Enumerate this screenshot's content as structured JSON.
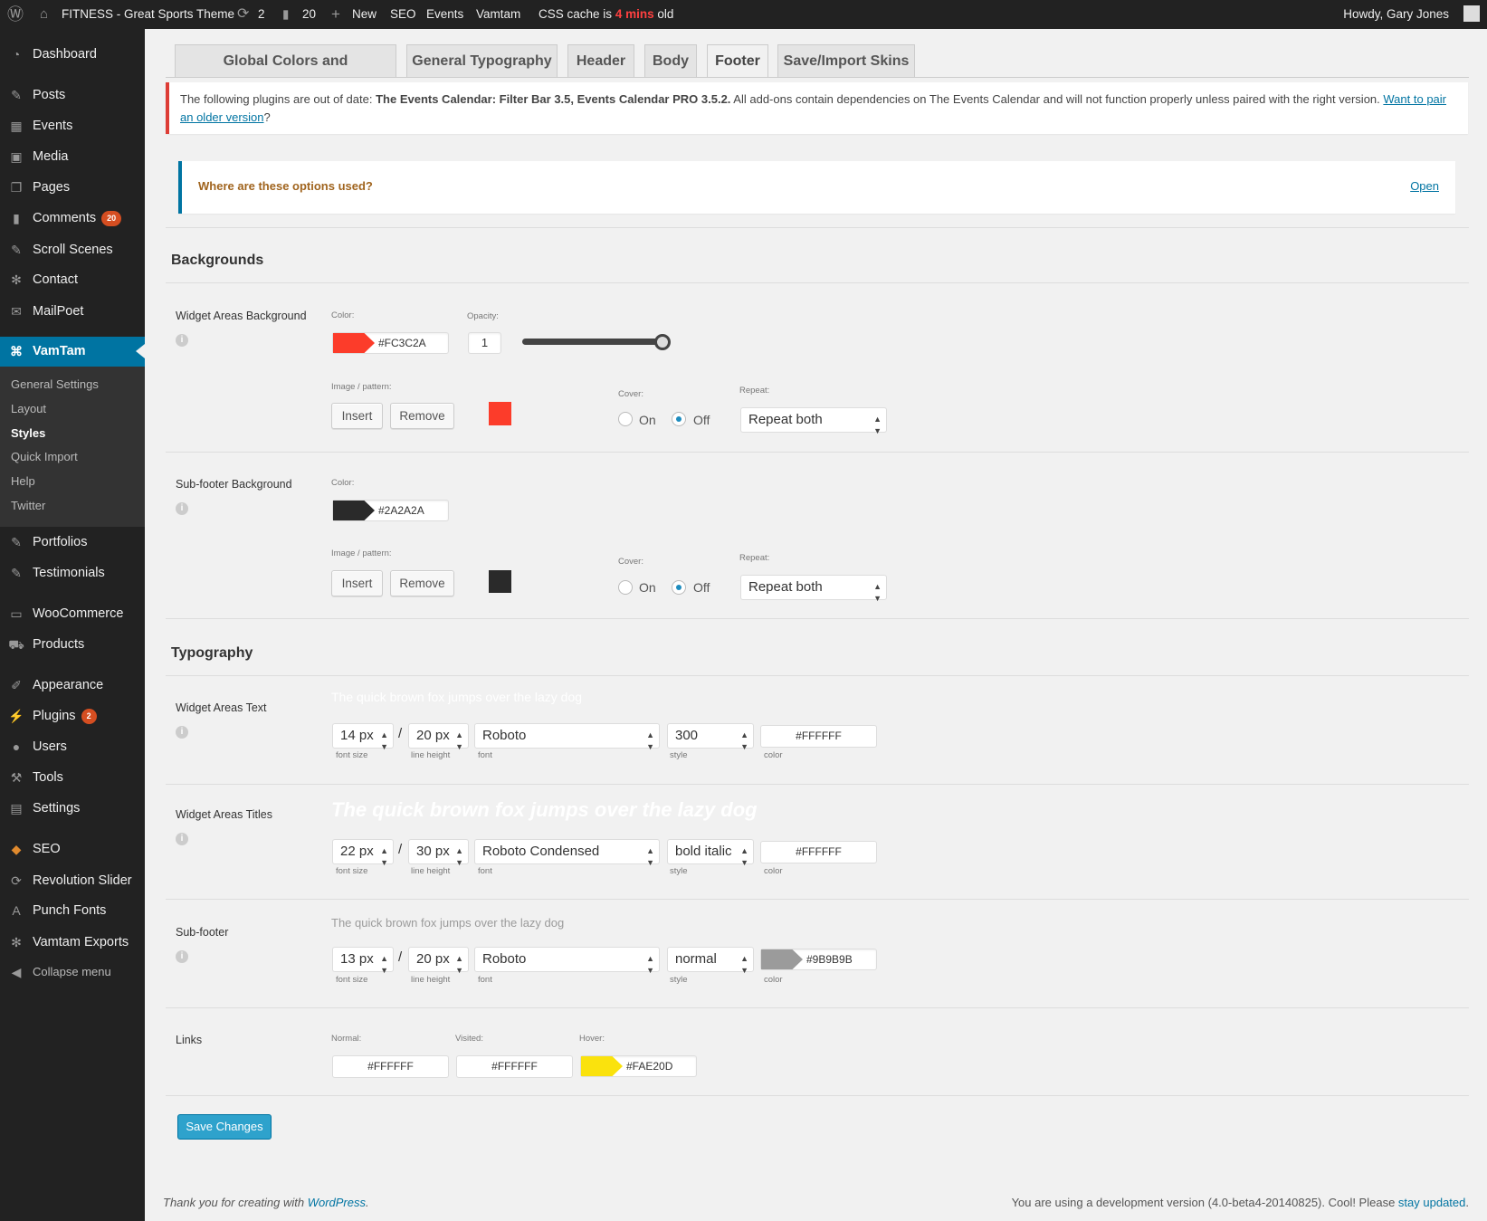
{
  "admin_bar": {
    "site_name": "FITNESS - Great Sports Theme",
    "updates_count": "2",
    "comments_count": "20",
    "new_label": "New",
    "seo_label": "SEO",
    "events_label": "Events",
    "vamtam_label": "Vamtam",
    "css_cache_prefix": "CSS cache is",
    "css_cache_age": "4 mins",
    "css_cache_suffix": "old",
    "howdy": "Howdy, Gary Jones"
  },
  "sidebar": {
    "items": [
      {
        "label": "Dashboard",
        "icon": "dashboard-icon"
      },
      {
        "label": "Posts",
        "icon": "pin-icon"
      },
      {
        "label": "Events",
        "icon": "calendar-icon"
      },
      {
        "label": "Media",
        "icon": "media-icon"
      },
      {
        "label": "Pages",
        "icon": "pages-icon"
      },
      {
        "label": "Comments",
        "icon": "comment-icon",
        "badge": "20"
      },
      {
        "label": "Scroll Scenes",
        "icon": "pin-icon"
      },
      {
        "label": "Contact",
        "icon": "gear-icon"
      },
      {
        "label": "MailPoet",
        "icon": "mail-icon"
      },
      {
        "label": "VamTam",
        "icon": "command-icon"
      },
      {
        "label": "Portfolios",
        "icon": "pin-icon"
      },
      {
        "label": "Testimonials",
        "icon": "pin-icon"
      },
      {
        "label": "WooCommerce",
        "icon": "woo-icon"
      },
      {
        "label": "Products",
        "icon": "cart-icon"
      },
      {
        "label": "Appearance",
        "icon": "brush-icon"
      },
      {
        "label": "Plugins",
        "icon": "plug-icon",
        "badge": "2"
      },
      {
        "label": "Users",
        "icon": "user-icon"
      },
      {
        "label": "Tools",
        "icon": "wrench-icon"
      },
      {
        "label": "Settings",
        "icon": "settings-icon"
      },
      {
        "label": "SEO",
        "icon": "seo-icon"
      },
      {
        "label": "Revolution Slider",
        "icon": "refresh-icon"
      },
      {
        "label": "Punch Fonts",
        "icon": "font-icon"
      },
      {
        "label": "Vamtam Exports",
        "icon": "gear-icon"
      },
      {
        "label": "Collapse menu",
        "icon": "collapse-icon"
      }
    ],
    "submenu": [
      "General Settings",
      "Layout",
      "Styles",
      "Quick Import",
      "Help",
      "Twitter"
    ],
    "active_sub": "Styles"
  },
  "tabs": [
    "Global Colors and Backgrounds",
    "General Typography",
    "Header",
    "Body",
    "Footer",
    "Save/Import Skins"
  ],
  "active_tab": "Footer",
  "notice": {
    "prefix": "The following plugins are out of date: ",
    "plugins": "The Events Calendar: Filter Bar 3.5, Events Calendar PRO 3.5.2.",
    "middle": " All add-ons contain dependencies on The Events Calendar and will not function properly unless paired with the right version. ",
    "link": "Want to pair an older version",
    "suffix": "?"
  },
  "options_box": {
    "question": "Where are these options used?",
    "open": "Open"
  },
  "backgrounds": {
    "heading": "Backgrounds",
    "labels": {
      "color": "Color:",
      "opacity": "Opacity:",
      "image": "Image / pattern:",
      "cover": "Cover:",
      "repeat": "Repeat:",
      "insert": "Insert",
      "remove": "Remove",
      "on": "On",
      "off": "Off"
    },
    "widget": {
      "label": "Widget Areas Background",
      "color": "#FC3C2A",
      "opacity": "1",
      "opacity_level": 1.0,
      "cover": "Off",
      "repeat": "Repeat both"
    },
    "subfooter": {
      "label": "Sub-footer Background",
      "color": "#2A2A2A",
      "cover": "Off",
      "repeat": "Repeat both"
    }
  },
  "typography": {
    "heading": "Typography",
    "sublabels": {
      "size": "font size",
      "lh": "line height",
      "font": "font",
      "style": "style",
      "color": "color"
    },
    "preview": "The quick brown fox jumps over the lazy dog",
    "rows": [
      {
        "label": "Widget Areas Text",
        "size": "14 px",
        "lh": "20 px",
        "font": "Roboto",
        "style": "300",
        "color": "#FFFFFF"
      },
      {
        "label": "Widget Areas Titles",
        "size": "22 px",
        "lh": "30 px",
        "font": "Roboto Condensed",
        "style": "bold italic",
        "color": "#FFFFFF"
      },
      {
        "label": "Sub-footer",
        "size": "13 px",
        "lh": "20 px",
        "font": "Roboto",
        "style": "normal",
        "color": "#9B9B9B"
      }
    ],
    "links": {
      "label": "Links",
      "normal_label": "Normal:",
      "visited_label": "Visited:",
      "hover_label": "Hover:",
      "normal": "#FFFFFF",
      "visited": "#FFFFFF",
      "hover": "#FAE20D"
    }
  },
  "save_label": "Save Changes",
  "footer": {
    "thanks": "Thank you for creating with ",
    "wp": "WordPress",
    "dot": ".",
    "version": "You are using a development version (4.0-beta4-20140825). Cool! Please ",
    "stay": "stay updated",
    "dot2": "."
  }
}
